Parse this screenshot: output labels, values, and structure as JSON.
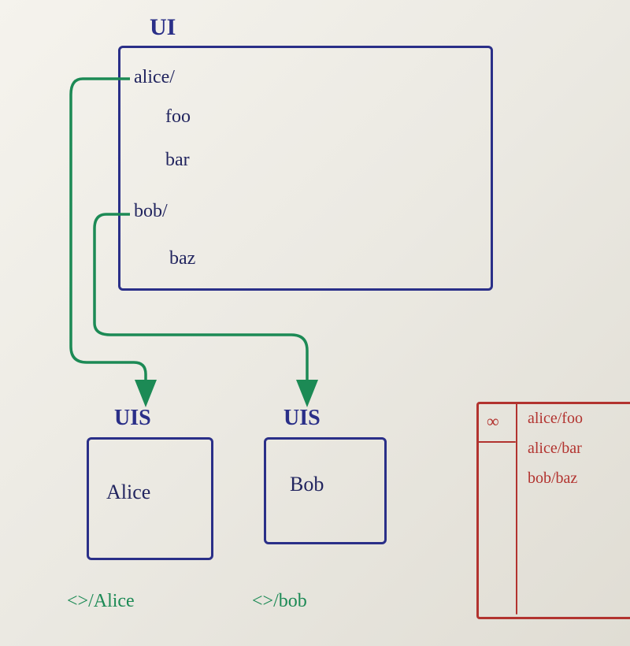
{
  "ui_box": {
    "title": "UI",
    "entries": {
      "dir1": "alice/",
      "file1": "foo",
      "file2": "bar",
      "dir2": "bob/",
      "file3": "baz"
    }
  },
  "uis_boxes": {
    "left": {
      "title": "UIS",
      "content": "Alice",
      "path_label": "<>/Alice"
    },
    "right": {
      "title": "UIS",
      "content": "Bob",
      "path_label": "<>/bob"
    }
  },
  "red_panel": {
    "header_symbol": "∞",
    "rows": [
      "alice/foo",
      "alice/bar",
      "bob/baz"
    ]
  },
  "colors": {
    "blue": "#2a2f88",
    "green": "#1c8a55",
    "red": "#b2332f"
  }
}
